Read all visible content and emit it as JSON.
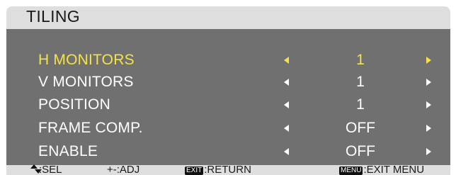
{
  "title": "TILING",
  "items": [
    {
      "label": "H MONITORS",
      "value": "1"
    },
    {
      "label": "V MONITORS",
      "value": "1"
    },
    {
      "label": "POSITION",
      "value": "1"
    },
    {
      "label": "FRAME COMP.",
      "value": "OFF"
    },
    {
      "label": "ENABLE",
      "value": "OFF"
    }
  ],
  "selected_index": 0,
  "footer": {
    "sel": ":SEL",
    "adj": "+-:ADJ",
    "exit_key": "EXIT",
    "return": ":RETURN",
    "menu_key": "MENU",
    "exit_menu": ":EXIT MENU"
  },
  "colors": {
    "title_bar": "#dedede",
    "panel": "#707070",
    "text": "#ffffff",
    "highlight": "#f5e24a"
  },
  "icons": {
    "decrease": "left-arrow-icon",
    "increase": "right-arrow-icon",
    "navigate": "up-down-arrow-icon"
  }
}
